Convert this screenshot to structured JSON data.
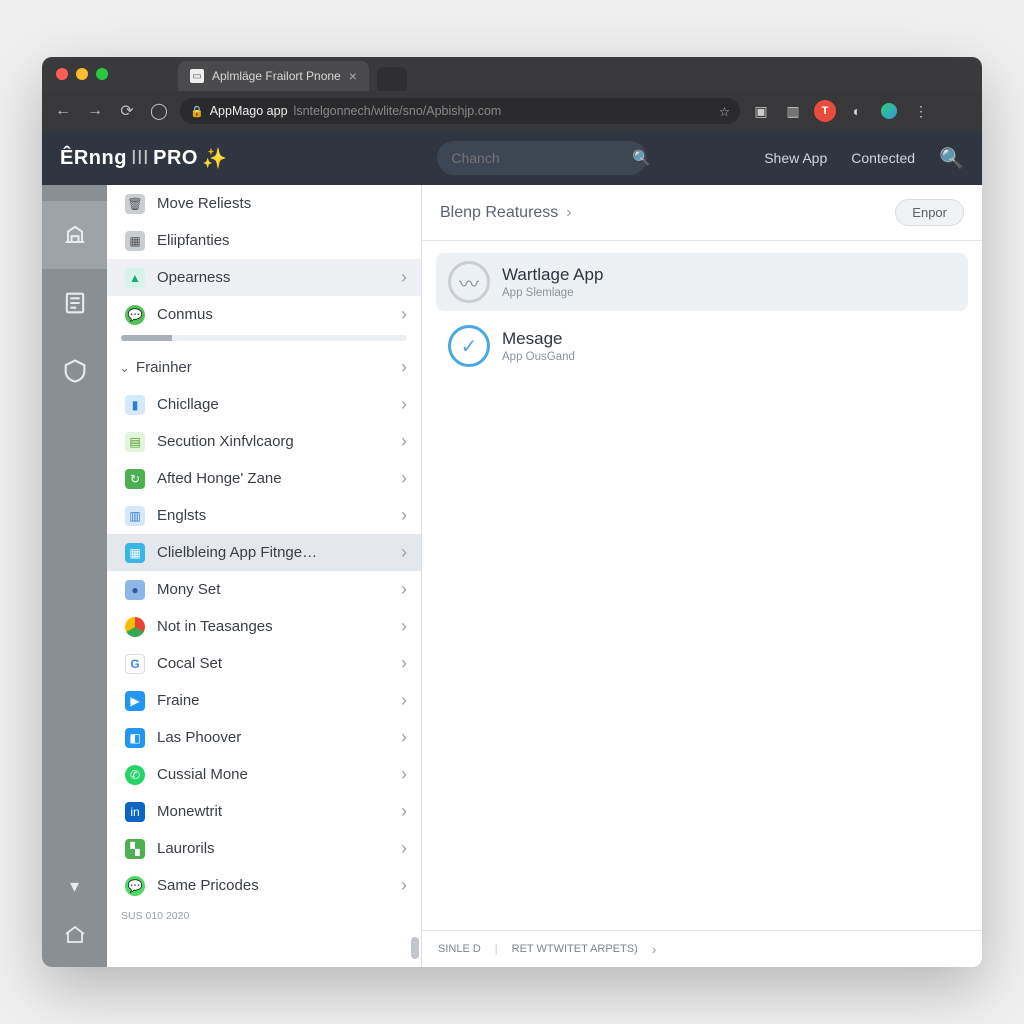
{
  "browser": {
    "tab_title": "Aplmläge Frailort Pnone",
    "url_display": "AppMago app",
    "url_path": "lsntelgonnech/wlite/sno/Apbishjp.com"
  },
  "header": {
    "logo_main": "ÊRnng",
    "logo_mid": "III",
    "logo_end": "PRO",
    "search_placeholder": "Chanch",
    "link_show": "Shew App",
    "link_contacted": "Contected"
  },
  "sidebar": {
    "top": [
      {
        "label": "Move Reliests",
        "icon": "ic-gray",
        "glyph": "🗑"
      },
      {
        "label": "Eliipfanties",
        "icon": "ic-gray",
        "glyph": "▦"
      },
      {
        "label": "Opearness",
        "icon": "ic-teal",
        "glyph": "▲",
        "chev": true,
        "hi": true
      },
      {
        "label": "Conmus",
        "icon": "ic-green",
        "glyph": "💬",
        "chev": true
      }
    ],
    "section_label": "Frainher",
    "items": [
      {
        "label": "Chicllage",
        "icon": "ic-blue",
        "glyph": "▮"
      },
      {
        "label": "Secution Xinfvlcaorg",
        "icon": "ic-lgreen",
        "glyph": "▤"
      },
      {
        "label": "Afted Honge' Zane",
        "icon": "ic-grn2",
        "glyph": "↻"
      },
      {
        "label": "Englsts",
        "icon": "ic-blue",
        "glyph": "▥"
      },
      {
        "label": "Clielbleing App Fitnge…",
        "icon": "ic-cyan",
        "glyph": "▦",
        "sel": true
      },
      {
        "label": "Mony Set",
        "icon": "ic-dblue",
        "glyph": "●"
      },
      {
        "label": "Not in Teasanges",
        "icon": "ic-chrome",
        "glyph": ""
      },
      {
        "label": "Cocal Set",
        "icon": "ic-g",
        "glyph": "G"
      },
      {
        "label": "Fraine",
        "icon": "ic-play",
        "glyph": "▶"
      },
      {
        "label": "Las Phoover",
        "icon": "ic-lbox",
        "glyph": "◧"
      },
      {
        "label": "Cussial Mone",
        "icon": "ic-wa",
        "glyph": "✆"
      },
      {
        "label": "Monewtrit",
        "icon": "ic-in",
        "glyph": "in"
      },
      {
        "label": "Laurorils",
        "icon": "ic-grn2",
        "glyph": "▚"
      },
      {
        "label": "Same Pricodes",
        "icon": "ic-msg",
        "glyph": "💬"
      }
    ],
    "footer_text": "SUS 010 2020"
  },
  "main": {
    "breadcrumb": "Blenp Reaturess",
    "button_label": "Enpor",
    "cards": [
      {
        "title": "Wartlage App",
        "subtitle": "App Slemlage",
        "sel": true,
        "blue": false,
        "glyph": "〰"
      },
      {
        "title": "Mesage",
        "subtitle": "App OusGand",
        "sel": false,
        "blue": true,
        "glyph": "✓"
      }
    ],
    "footer_left": "SINLE D",
    "footer_right": "RET WTWITET ARPETS)"
  }
}
